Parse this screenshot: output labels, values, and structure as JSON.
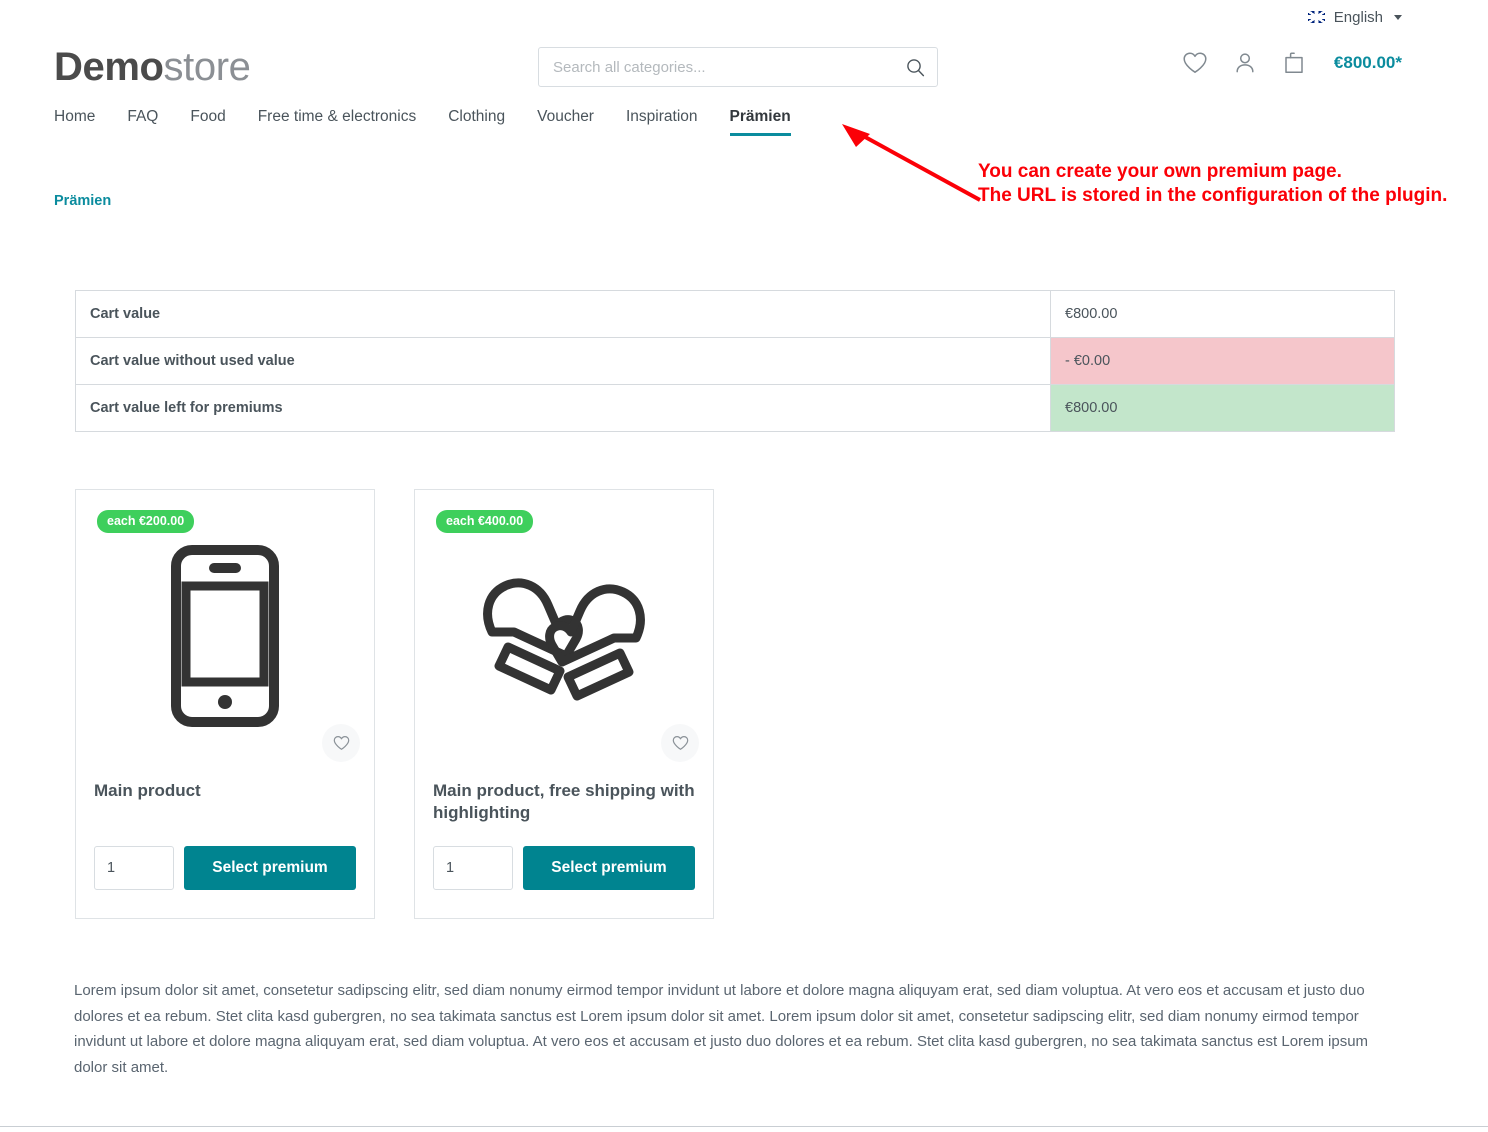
{
  "topbar": {
    "language_label": "English",
    "flag_icon": "uk-flag-icon",
    "caret_icon": "chevron-down-icon"
  },
  "header": {
    "logo_bold": "Demo",
    "logo_light": "store",
    "search_placeholder": "Search all categories...",
    "search_value": "",
    "search_icon": "search-icon",
    "wishlist_icon": "heart-icon",
    "account_icon": "person-icon",
    "cart_icon": "bag-icon",
    "cart_total": "€800.00*"
  },
  "nav": {
    "items": [
      {
        "label": "Home",
        "active": false
      },
      {
        "label": "FAQ",
        "active": false
      },
      {
        "label": "Food",
        "active": false
      },
      {
        "label": "Free time & electronics",
        "active": false
      },
      {
        "label": "Clothing",
        "active": false
      },
      {
        "label": "Voucher",
        "active": false
      },
      {
        "label": "Inspiration",
        "active": false
      },
      {
        "label": "Prämien",
        "active": true
      }
    ]
  },
  "breadcrumb": {
    "label": "Prämien"
  },
  "annotation": {
    "text": "You can create your own premium page.\nThe URL is stored in the configuration of the plugin.",
    "color": "#fb0007"
  },
  "cart_table": {
    "rows": [
      {
        "label": "Cart value",
        "value": "€800.00",
        "style": "plain"
      },
      {
        "label": "Cart value without used value",
        "value": "- €0.00",
        "style": "negative"
      },
      {
        "label": "Cart value left for premiums",
        "value": "€800.00",
        "style": "positive"
      }
    ],
    "negative_bg": "#f5c6cb",
    "positive_bg": "#c3e6cb"
  },
  "products": [
    {
      "badge": "each €200.00",
      "title": "Main product",
      "image_icon": "smartphone-icon",
      "wishlist_icon": "heart-icon",
      "quantity": "1",
      "button_label": "Select premium"
    },
    {
      "badge": "each €400.00",
      "title": "Main product, free shipping with highlighting",
      "image_icon": "mittens-icon",
      "wishlist_icon": "heart-icon",
      "quantity": "1",
      "button_label": "Select premium"
    }
  ],
  "footer_text": "Lorem ipsum dolor sit amet, consetetur sadipscing elitr, sed diam nonumy eirmod tempor invidunt ut labore et dolore magna aliquyam erat, sed diam voluptua. At vero eos et accusam et justo duo dolores et ea rebum. Stet clita kasd gubergren, no sea takimata sanctus est Lorem ipsum dolor sit amet. Lorem ipsum dolor sit amet, consetetur sadipscing elitr, sed diam nonumy eirmod tempor invidunt ut labore et dolore magna aliquyam erat, sed diam voluptua. At vero eos et accusam et justo duo dolores et ea rebum. Stet clita kasd gubergren, no sea takimata sanctus est Lorem ipsum dolor sit amet.",
  "colors": {
    "accent_teal": "#0b8c9e",
    "button_teal": "#008490",
    "badge_green": "#3ecf5c",
    "annotation_red": "#fb0007"
  }
}
